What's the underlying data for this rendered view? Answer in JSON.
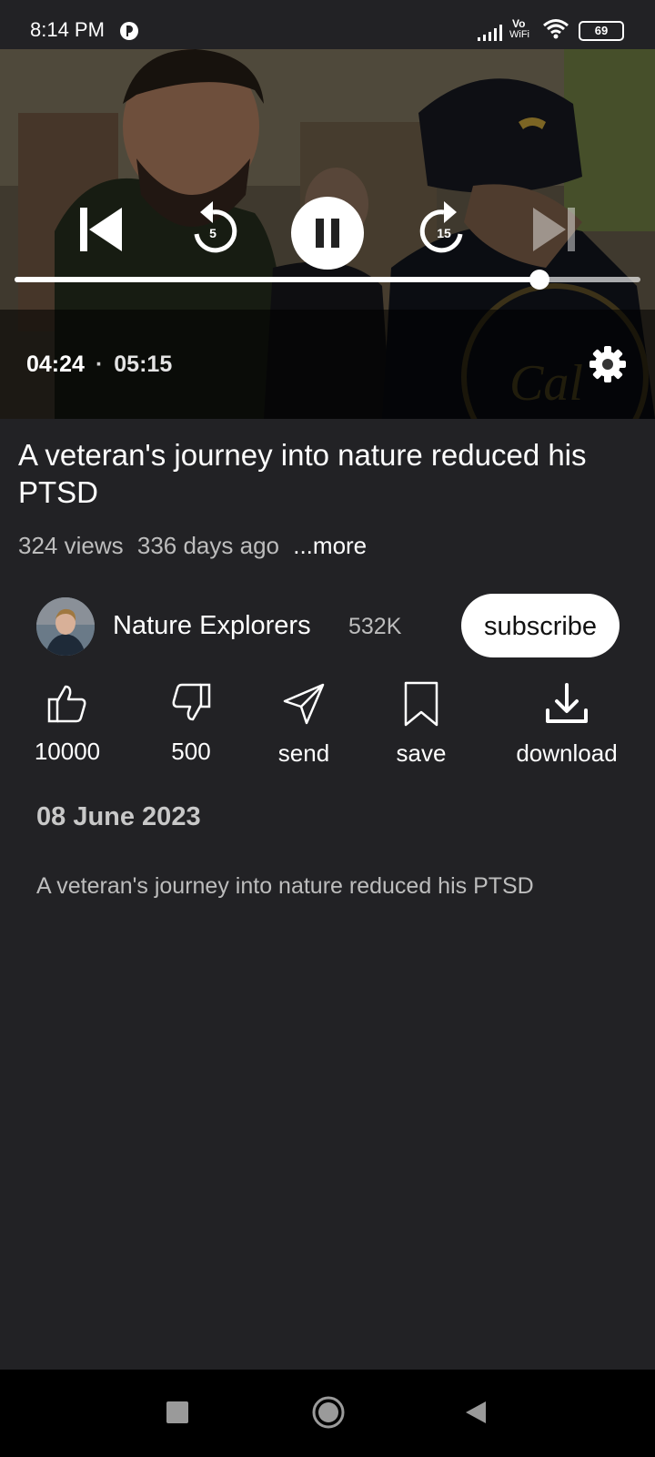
{
  "status_bar": {
    "time": "8:14 PM",
    "battery": "69",
    "vowifi_top": "Vo",
    "vowifi_bottom": "WiFi",
    "icons": [
      "notification-icon",
      "signal-icon",
      "vowifi-icon",
      "wifi-icon",
      "battery-icon"
    ]
  },
  "player": {
    "rewind_seconds": "5",
    "forward_seconds": "15",
    "current_time": "04:24",
    "separator": "·",
    "total_time": "05:15",
    "progress": 0.838,
    "is_playing": true,
    "next_enabled": false,
    "icons": [
      "previous-icon",
      "rewind-icon",
      "pause-icon",
      "forward-icon",
      "next-icon",
      "settings-icon"
    ]
  },
  "video": {
    "title": "A veteran's journey into nature reduced his PTSD",
    "views": "324 views",
    "age": "336 days ago",
    "more": "...more"
  },
  "channel": {
    "name": "Nature Explorers",
    "subscribers": "532K",
    "subscribe_label": "subscribe"
  },
  "actions": [
    {
      "label": "10000",
      "icon": "thumbs-up-icon"
    },
    {
      "label": "500",
      "icon": "thumbs-down-icon"
    },
    {
      "label": "send",
      "icon": "send-icon"
    },
    {
      "label": "save",
      "icon": "bookmark-icon"
    },
    {
      "label": "download",
      "icon": "download-icon"
    }
  ],
  "description": {
    "date": "08 June 2023",
    "text": "A veteran's journey into nature reduced his PTSD"
  },
  "nav_bar": {
    "icons": [
      "recents-icon",
      "home-icon",
      "back-icon"
    ]
  },
  "colors": {
    "background": "#222225",
    "text_primary": "#ffffff",
    "text_secondary": "#bdbdbd",
    "nav_background": "#000000"
  }
}
